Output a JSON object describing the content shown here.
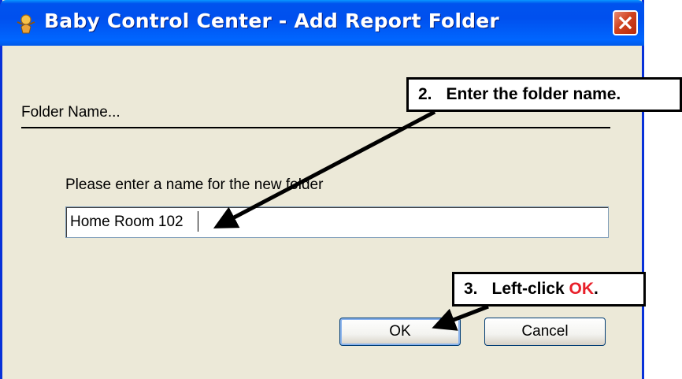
{
  "window": {
    "title": "Baby Control Center - Add Report Folder",
    "icon": "app-icon"
  },
  "form": {
    "section_label": "Folder Name...",
    "prompt": "Please enter a name for the new folder",
    "folder_name_value": "Home Room 102"
  },
  "buttons": {
    "ok_label": "OK",
    "cancel_label": "Cancel"
  },
  "callouts": {
    "step2_number": "2.",
    "step2_text": "Enter the folder name.",
    "step3_number": "3.",
    "step3_text": "Left-click ",
    "step3_highlight": "OK",
    "step3_suffix": "."
  },
  "colors": {
    "titlebar": "#0054e3",
    "dialog_bg": "#ece9d8",
    "highlight_red": "#e8202a",
    "close_button": "#d0421f"
  }
}
